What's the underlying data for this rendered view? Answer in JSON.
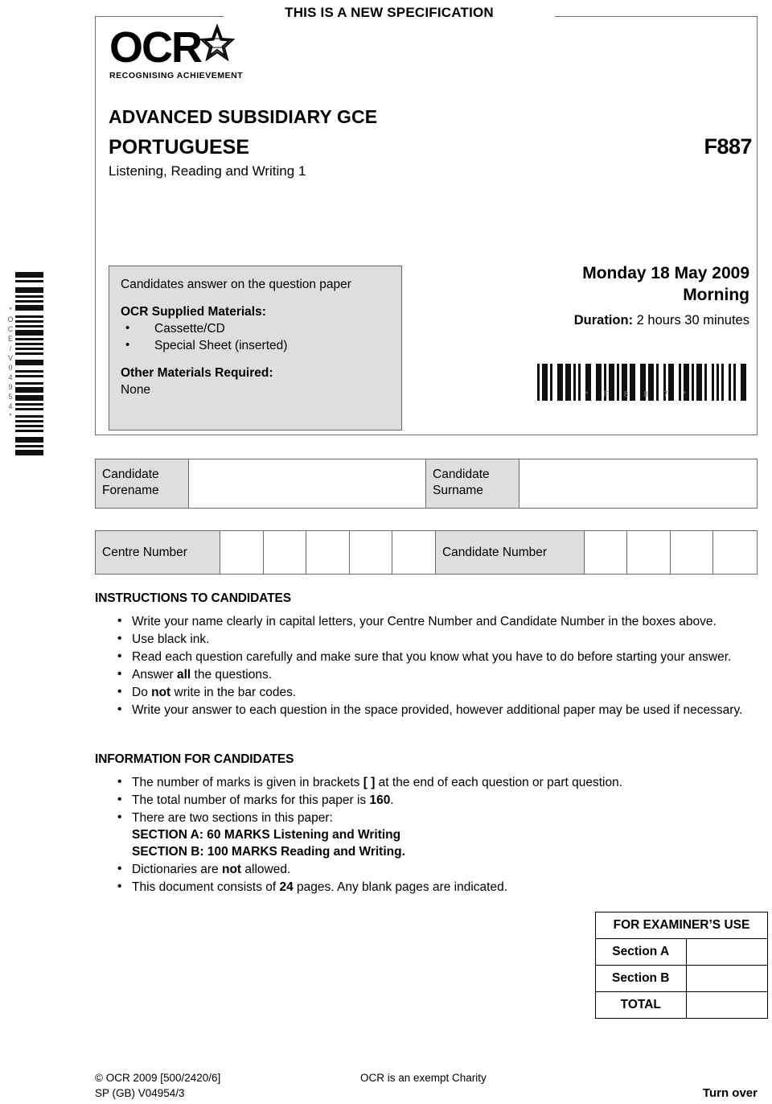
{
  "banner": {
    "text": "THIS IS A NEW SPECIFICATION"
  },
  "logo": {
    "wordmark": "OCR",
    "tagline": "RECOGNISING ACHIEVEMENT",
    "star_icon": "star-icon"
  },
  "header": {
    "qualification": "ADVANCED SUBSIDIARY GCE",
    "subject": "PORTUGUESE",
    "paper_code": "F887",
    "paper_title": "Listening, Reading and Writing 1"
  },
  "materials": {
    "answer_note": "Candidates answer on the question paper",
    "supplied_heading": "OCR Supplied Materials:",
    "supplied_items": [
      "Cassette/CD",
      "Special Sheet (inserted)"
    ],
    "other_heading": "Other Materials Required:",
    "other_value": "None"
  },
  "exam": {
    "date": "Monday 18 May 2009",
    "session": "Morning",
    "duration_label": "Duration:",
    "duration_value": "2 hours 30 minutes"
  },
  "barcodes": {
    "vertical_text": "*OCE/V04954*",
    "horizontal_text": "*F887*"
  },
  "candidate_fields": {
    "forename_label": "Candidate\nForename",
    "forename_label_line1": "Candidate",
    "forename_label_line2": "Forename",
    "surname_label_line1": "Candidate",
    "surname_label_line2": "Surname",
    "forename_value": "",
    "surname_value": "",
    "centre_number_label": "Centre Number",
    "candidate_number_label": "Candidate Number",
    "centre_number_boxes": 5,
    "candidate_number_boxes": 4
  },
  "instructions": {
    "heading": "INSTRUCTIONS TO CANDIDATES",
    "items": [
      "Write your name clearly in capital letters, your Centre Number and Candidate Number in the boxes above.",
      "Use black ink.",
      "Read each question carefully and make sure that you know what you have to do before starting your answer.",
      "Answer all the questions.",
      "Do not write in the bar codes.",
      "Write your answer to each question in the space provided, however additional paper may be used if necessary."
    ]
  },
  "information": {
    "heading": "INFORMATION FOR CANDIDATES",
    "item1": "The number of marks is given in brackets [   ] at the end of each question or part question.",
    "item2_prefix": "The total number of marks for this paper is ",
    "item2_value": "160",
    "item2_suffix": ".",
    "item3_intro": "There are two sections in this paper:",
    "item3_section_a": "SECTION A: 60 MARKS    Listening and Writing",
    "item3_section_b": "SECTION B: 100 MARKS  Reading and Writing.",
    "item4_prefix": "Dictionaries are ",
    "item4_bold": "not",
    "item4_suffix": " allowed.",
    "item5_prefix": "This document consists of ",
    "item5_value": "24",
    "item5_suffix": " pages. Any blank pages are indicated."
  },
  "examiner_table": {
    "heading": "FOR EXAMINER’S USE",
    "rows": [
      {
        "label": "Section A",
        "mark": ""
      },
      {
        "label": "Section B",
        "mark": ""
      },
      {
        "label": "TOTAL",
        "mark": ""
      }
    ]
  },
  "footer": {
    "copyright": "© OCR 2009  [500/2420/6]",
    "sp_code": "SP (GB) V04954/3",
    "charity": "OCR is an exempt Charity",
    "turn_over": "Turn over"
  }
}
